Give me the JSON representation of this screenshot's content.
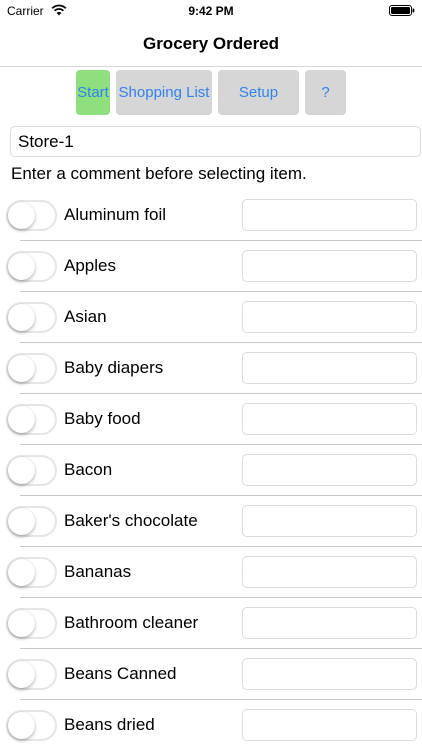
{
  "status_bar": {
    "carrier": "Carrier",
    "time": "9:42 PM",
    "icons": [
      "wifi-icon",
      "battery-icon"
    ]
  },
  "nav": {
    "title": "Grocery Ordered"
  },
  "toolbar": {
    "start_label": "Start",
    "list_label": "Shopping List",
    "setup_label": "Setup",
    "help_label": "?"
  },
  "store": {
    "value": "Store-1"
  },
  "hint": "Enter a comment before selecting item.",
  "colors": {
    "accent": "#2f83f0",
    "start_bg": "#8ee07f",
    "button_bg": "#d6d6d6"
  },
  "items": [
    {
      "label": "Aluminum foil",
      "on": false,
      "comment": ""
    },
    {
      "label": "Apples",
      "on": false,
      "comment": ""
    },
    {
      "label": "Asian",
      "on": false,
      "comment": ""
    },
    {
      "label": "Baby diapers",
      "on": false,
      "comment": ""
    },
    {
      "label": "Baby food",
      "on": false,
      "comment": ""
    },
    {
      "label": "Bacon",
      "on": false,
      "comment": ""
    },
    {
      "label": "Baker's chocolate",
      "on": false,
      "comment": ""
    },
    {
      "label": "Bananas",
      "on": false,
      "comment": ""
    },
    {
      "label": "Bathroom cleaner",
      "on": false,
      "comment": ""
    },
    {
      "label": "Beans Canned",
      "on": false,
      "comment": ""
    },
    {
      "label": "Beans dried",
      "on": false,
      "comment": ""
    }
  ]
}
